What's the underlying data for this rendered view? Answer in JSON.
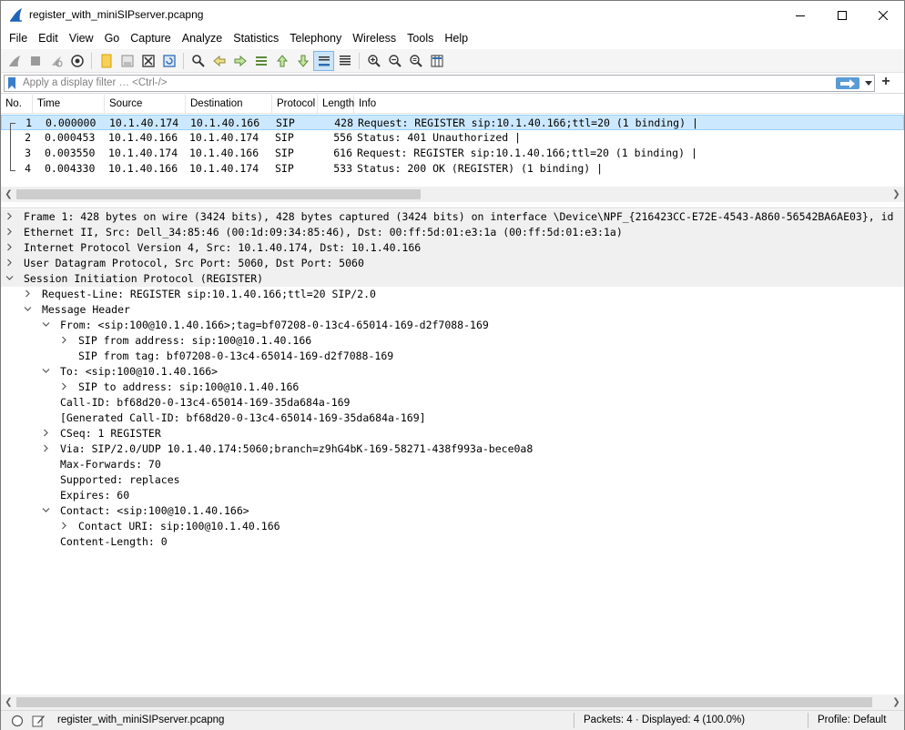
{
  "window": {
    "title": "register_with_miniSIPserver.pcapng"
  },
  "menu": [
    "File",
    "Edit",
    "View",
    "Go",
    "Capture",
    "Analyze",
    "Statistics",
    "Telephony",
    "Wireless",
    "Tools",
    "Help"
  ],
  "toolbar_icons": [
    "shark-start-icon",
    "stop-icon",
    "restart-icon",
    "options-icon",
    "open-file-icon",
    "save-icon",
    "close-file-icon",
    "reload-icon",
    "find-icon",
    "back-icon",
    "forward-icon",
    "go-to-packet-icon",
    "first-packet-icon",
    "last-packet-icon",
    "autoscroll-icon",
    "colorize-icon",
    "zoom-in-icon",
    "zoom-out-icon",
    "normal-size-icon",
    "resize-columns-icon"
  ],
  "filter": {
    "placeholder": "Apply a display filter … <Ctrl-/>"
  },
  "packet_list": {
    "columns": [
      "No.",
      "Time",
      "Source",
      "Destination",
      "Protocol",
      "Length",
      "Info"
    ],
    "rows": [
      {
        "no": "1",
        "time": "0.000000",
        "source": "10.1.40.174",
        "destination": "10.1.40.166",
        "protocol": "SIP",
        "length": "428",
        "info": "Request: REGISTER sip:10.1.40.166;ttl=20  (1 binding) |",
        "selected": true
      },
      {
        "no": "2",
        "time": "0.000453",
        "source": "10.1.40.166",
        "destination": "10.1.40.174",
        "protocol": "SIP",
        "length": "556",
        "info": "Status: 401 Unauthorized |",
        "selected": false
      },
      {
        "no": "3",
        "time": "0.003550",
        "source": "10.1.40.174",
        "destination": "10.1.40.166",
        "protocol": "SIP",
        "length": "616",
        "info": "Request: REGISTER sip:10.1.40.166;ttl=20  (1 binding) |",
        "selected": false
      },
      {
        "no": "4",
        "time": "0.004330",
        "source": "10.1.40.166",
        "destination": "10.1.40.174",
        "protocol": "SIP",
        "length": "533",
        "info": "Status: 200 OK (REGISTER)  (1 binding) |",
        "selected": false
      }
    ]
  },
  "details": [
    {
      "text": "Frame 1: 428 bytes on wire (3424 bits), 428 bytes captured (3424 bits) on interface \\Device\\NPF_{216423CC-E72E-4543-A860-56542BA6AE03}, id",
      "level": 0,
      "arrow": "collapsed",
      "top": true
    },
    {
      "text": "Ethernet II, Src: Dell_34:85:46 (00:1d:09:34:85:46), Dst: 00:ff:5d:01:e3:1a (00:ff:5d:01:e3:1a)",
      "level": 0,
      "arrow": "collapsed",
      "top": true
    },
    {
      "text": "Internet Protocol Version 4, Src: 10.1.40.174, Dst: 10.1.40.166",
      "level": 0,
      "arrow": "collapsed",
      "top": true
    },
    {
      "text": "User Datagram Protocol, Src Port: 5060, Dst Port: 5060",
      "level": 0,
      "arrow": "collapsed",
      "top": true
    },
    {
      "text": "Session Initiation Protocol (REGISTER)",
      "level": 0,
      "arrow": "expanded",
      "top": true
    },
    {
      "text": "Request-Line: REGISTER sip:10.1.40.166;ttl=20 SIP/2.0",
      "level": 1,
      "arrow": "collapsed",
      "top": false
    },
    {
      "text": "Message Header",
      "level": 1,
      "arrow": "expanded",
      "top": false
    },
    {
      "text": "From: <sip:100@10.1.40.166>;tag=bf07208-0-13c4-65014-169-d2f7088-169",
      "level": 2,
      "arrow": "expanded",
      "top": false
    },
    {
      "text": "SIP from address: sip:100@10.1.40.166",
      "level": 3,
      "arrow": "collapsed",
      "top": false
    },
    {
      "text": "SIP from tag: bf07208-0-13c4-65014-169-d2f7088-169",
      "level": 3,
      "arrow": "none",
      "top": false
    },
    {
      "text": "To: <sip:100@10.1.40.166>",
      "level": 2,
      "arrow": "expanded",
      "top": false
    },
    {
      "text": "SIP to address: sip:100@10.1.40.166",
      "level": 3,
      "arrow": "collapsed",
      "top": false
    },
    {
      "text": "Call-ID: bf68d20-0-13c4-65014-169-35da684a-169",
      "level": 2,
      "arrow": "none",
      "top": false
    },
    {
      "text": "[Generated Call-ID: bf68d20-0-13c4-65014-169-35da684a-169]",
      "level": 2,
      "arrow": "none",
      "top": false
    },
    {
      "text": "CSeq: 1 REGISTER",
      "level": 2,
      "arrow": "collapsed",
      "top": false
    },
    {
      "text": "Via: SIP/2.0/UDP 10.1.40.174:5060;branch=z9hG4bK-169-58271-438f993a-bece0a8",
      "level": 2,
      "arrow": "collapsed",
      "top": false
    },
    {
      "text": "Max-Forwards: 70",
      "level": 2,
      "arrow": "none",
      "top": false
    },
    {
      "text": "Supported: replaces",
      "level": 2,
      "arrow": "none",
      "top": false
    },
    {
      "text": "Expires: 60",
      "level": 2,
      "arrow": "none",
      "top": false
    },
    {
      "text": "Contact: <sip:100@10.1.40.166>",
      "level": 2,
      "arrow": "expanded",
      "top": false
    },
    {
      "text": "Contact URI: sip:100@10.1.40.166",
      "level": 3,
      "arrow": "collapsed",
      "top": false
    },
    {
      "text": "Content-Length: 0",
      "level": 2,
      "arrow": "none",
      "top": false
    }
  ],
  "status": {
    "file": "register_with_miniSIPserver.pcapng",
    "packets": "Packets: 4 · Displayed: 4 (100.0%)",
    "profile": "Profile: Default"
  },
  "colors": {
    "selected_bg": "#cce8ff",
    "apply_blue": "#5a9bd5",
    "top_level_bg": "#f0f0f0"
  }
}
